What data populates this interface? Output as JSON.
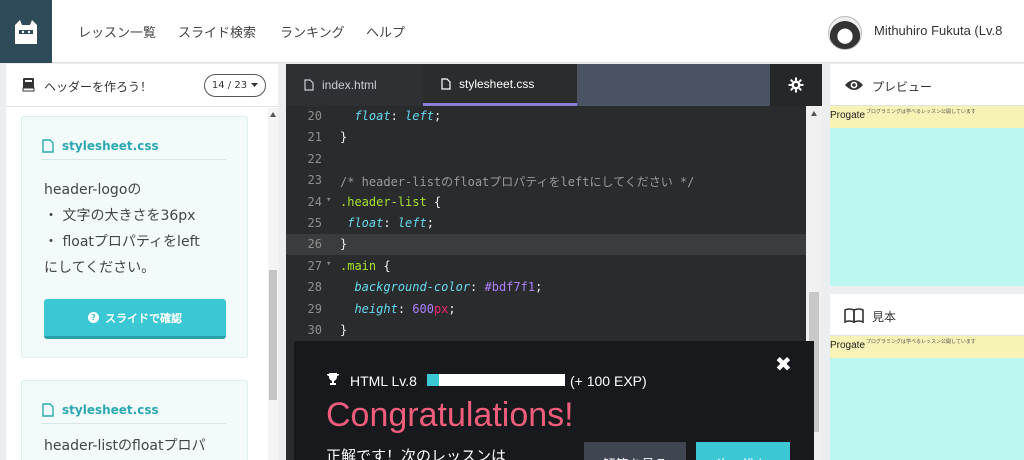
{
  "nav": {
    "items": [
      "レッスン一覧",
      "スライド検索",
      "ランキング",
      "ヘルプ"
    ],
    "username": "Mithuhiro Fukuta (Lv.8"
  },
  "lesson": {
    "title": "ヘッダーを作ろう！",
    "progress": "14 / 23"
  },
  "cards": [
    {
      "file": "stylesheet.css",
      "lines": [
        "header-logoの",
        "・ 文字の大きさを36px",
        "・ floatプロパティをleft",
        "にしてください。"
      ],
      "button": "スライドで確認"
    },
    {
      "file": "stylesheet.css",
      "lines": [
        "header-listのfloatプロパ"
      ]
    }
  ],
  "editor": {
    "tabs": [
      "index.html",
      "stylesheet.css"
    ],
    "active_tab": "stylesheet.css",
    "lines": [
      {
        "n": "20",
        "text": "  float: left;"
      },
      {
        "n": "21",
        "text": "}"
      },
      {
        "n": "22",
        "text": ""
      },
      {
        "n": "23",
        "text": "/* header-listのfloatプロパティをleftにしてください */"
      },
      {
        "n": "24",
        "text": ".header-list {"
      },
      {
        "n": "25",
        "text": " float: left;"
      },
      {
        "n": "26",
        "text": "}"
      },
      {
        "n": "27",
        "text": ".main {"
      },
      {
        "n": "28",
        "text": "  background-color: #bdf7f1;"
      },
      {
        "n": "29",
        "text": "  height: 600px;"
      },
      {
        "n": "30",
        "text": "}"
      }
    ]
  },
  "modal": {
    "level": "HTML Lv.8",
    "xp_fraction": 0.09,
    "xp_gain": "(+ 100 EXP)",
    "title": "Congratulations!",
    "message": "正解です！次のレッスンは",
    "button_review": "解答を見る",
    "button_next": "次へ進む"
  },
  "preview": {
    "title": "プレビュー",
    "logo": "Progate",
    "small": "プログラミングは学べるレッスン公開しています",
    "bg_color": "#bdf7f1",
    "header_color": "#f7f2b5"
  },
  "sample": {
    "title": "見本",
    "logo": "Progate",
    "small": "プログラミングは学べるレッスン公開しています"
  }
}
